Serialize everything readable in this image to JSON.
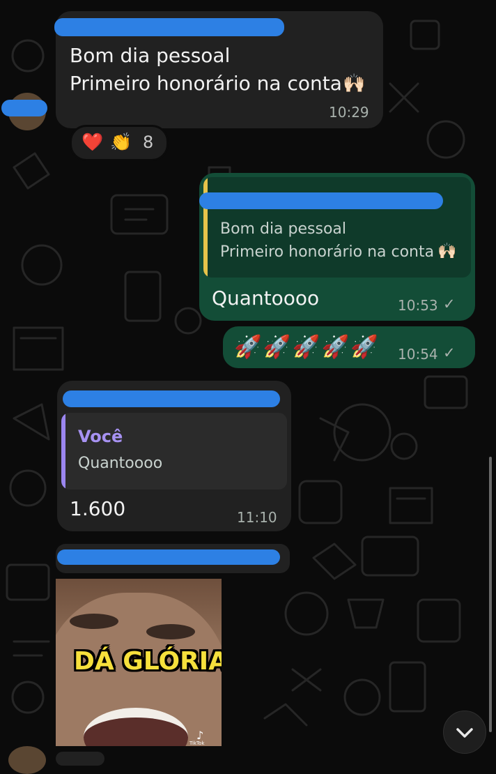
{
  "messages": {
    "m1": {
      "line1": "Bom dia pessoal",
      "line2": "Primeiro honorário na conta",
      "emoji": "🙌🏻",
      "time": "10:29",
      "reactions": {
        "heart": "❤️",
        "clap": "👏",
        "count": "8"
      }
    },
    "m2": {
      "quote_line1": "Bom dia pessoal",
      "quote_line2": "Primeiro honorário na conta",
      "quote_emoji": "🙌🏻",
      "text": "Quantoooo",
      "time": "10:53",
      "status": "✓"
    },
    "m3": {
      "rockets": "🚀🚀🚀🚀🚀",
      "time": "10:54",
      "status": "✓"
    },
    "m4": {
      "quote_author": "Você",
      "quote_text": "Quantoooo",
      "text": "1.600",
      "time": "11:10"
    },
    "m5": {
      "video_caption": "DÁ GLÓRIA",
      "video_badge": "TikTok"
    }
  },
  "colors": {
    "background": "#0b0b0b",
    "incoming_bubble": "#212121",
    "outgoing_bubble": "#134d37",
    "quote_bar_yellow": "#e6c34a",
    "quote_bar_purple": "#9b86f0",
    "redaction": "#2d80e4",
    "caption_fill": "#f6e03c"
  },
  "icons": {
    "scroll_down": "chevron-down-icon",
    "status": "check-icon"
  }
}
